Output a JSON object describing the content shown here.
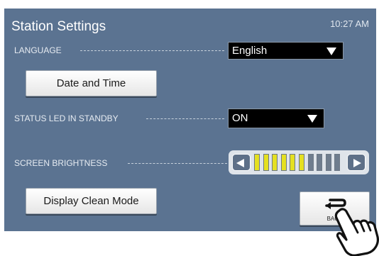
{
  "screen": {
    "title": "Station Settings",
    "time": "10:27 AM"
  },
  "language": {
    "label": "LANGUAGE",
    "value": "English"
  },
  "date_time_button": "Date and Time",
  "status_led": {
    "label": "STATUS LED IN STANDBY",
    "value": "ON"
  },
  "brightness": {
    "label": "SCREEN BRIGHTNESS",
    "level": 6,
    "max": 10
  },
  "clean_mode_button": "Display Clean Mode",
  "back_button": "BACK",
  "colors": {
    "panel": "#5b7391",
    "segment_on": "#e5e021",
    "segment_off": "#6f7d8e"
  }
}
